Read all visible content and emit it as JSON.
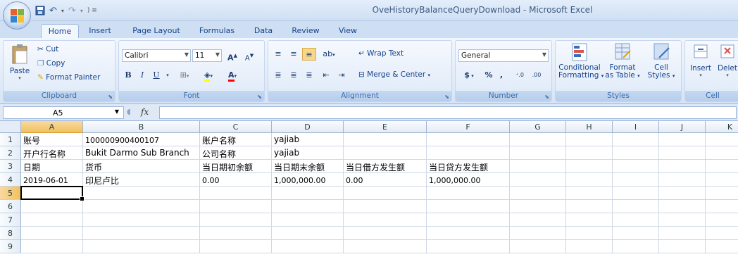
{
  "window": {
    "title": "OveHistoryBalanceQueryDownload - Microsoft Excel"
  },
  "qat": {
    "save_icon": "save-icon",
    "undo_icon": "undo-icon",
    "redo_icon": "redo-icon"
  },
  "tabs": [
    "Home",
    "Insert",
    "Page Layout",
    "Formulas",
    "Data",
    "Review",
    "View"
  ],
  "ribbon": {
    "clipboard": {
      "label": "Clipboard",
      "paste": "Paste",
      "cut": "Cut",
      "copy": "Copy",
      "format_painter": "Format Painter"
    },
    "font": {
      "label": "Font",
      "name": "Calibri",
      "size": "11",
      "bold": "B",
      "italic": "I",
      "underline": "U"
    },
    "alignment": {
      "label": "Alignment",
      "wrap_text": "Wrap Text",
      "merge_center": "Merge & Center"
    },
    "number": {
      "label": "Number",
      "format": "General",
      "currency": "$",
      "percent": "%",
      "comma": ","
    },
    "styles": {
      "label": "Styles",
      "conditional": "Conditional",
      "conditional2": "Formatting",
      "format_as": "Format",
      "format_as2": "as Table",
      "cell": "Cell",
      "cell2": "Styles"
    },
    "cells": {
      "label": "Cell",
      "insert": "Insert",
      "delete": "Delet"
    }
  },
  "formula_bar": {
    "name_box": "A5",
    "fx": "fx",
    "content": ""
  },
  "columns": [
    "A",
    "B",
    "C",
    "D",
    "E",
    "F",
    "G",
    "H",
    "I",
    "J",
    "K"
  ],
  "rows": [
    "1",
    "2",
    "3",
    "4",
    "5",
    "6",
    "7",
    "8",
    "9"
  ],
  "cells": {
    "r1": [
      "账号",
      "100000900400107",
      "账户名称",
      "yajiab",
      "",
      ""
    ],
    "r2": [
      "开户行名称",
      "Bukit Darmo Sub Branch",
      "公司名称",
      "yajiab",
      "",
      ""
    ],
    "r3": [
      "日期",
      "货币",
      "当日期初余额",
      "当日期末余额",
      "当日借方发生额",
      "当日贷方发生额"
    ],
    "r4": [
      "2019-06-01",
      "印尼卢比",
      "0.00",
      "1,000,000.00",
      "0.00",
      "1,000,000.00"
    ]
  },
  "selected_cell": "A5",
  "colors": {
    "ribbon_bg": "#dfe9f7",
    "selected_header": "#f1c15f",
    "grid_line": "#d0d7e5"
  }
}
